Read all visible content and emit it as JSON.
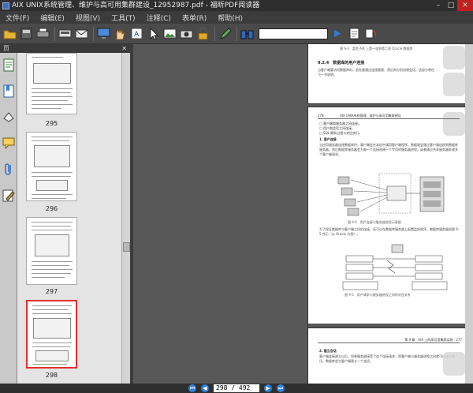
{
  "window": {
    "title": "AIX UNIX系统管理、维护与高可用集群建设_12952987.pdf - 福昕PDF阅读器"
  },
  "menu": [
    "文件(F)",
    "编辑(E)",
    "视图(V)",
    "工具(T)",
    "注释(C)",
    "表单(R)",
    "帮助(H)"
  ],
  "toolbar": {
    "icons": [
      "open-icon",
      "print-icon",
      "printer-icon",
      "scan-icon",
      "email-icon",
      "hand-icon",
      "select-text-icon",
      "pointer-icon",
      "snapshot-icon",
      "image-icon",
      "lock-icon",
      "pen-icon",
      "binoculars-icon",
      "zoom-in-icon",
      "fit-icon",
      "rotate-icon"
    ],
    "search_value": ""
  },
  "sidebar": {
    "header": "页",
    "close": "✕",
    "tabs": [
      "pages-tab",
      "bookmarks-tab",
      "layers-tab",
      "comments-tab",
      "attachments-tab",
      "sign-tab"
    ],
    "thumbnails": [
      {
        "label": "295"
      },
      {
        "label": "296"
      },
      {
        "label": "297"
      },
      {
        "label": "298",
        "selected": true
      }
    ]
  },
  "document": {
    "top_page": {
      "caption": "图 9-3　监控 AIX 上第一张到第二张 Oracle 数据库",
      "section": "9.2.4　数据库的用户连接",
      "body": "当客户端要访问数据库时，首先要通过连接管理，然后再分别创建会话，这部分将在下一节说明。"
    },
    "main_page": {
      "header_left": "278",
      "header_mid": "AIX UNIX系统管理、维护与高可用集群建设",
      "list": [
        "□ 客户端和服务器之间连接。",
        "□ 用户和会话之间连接。",
        "□ SQL 解析过程与对应执行。"
      ],
      "section": "1. 客户连接",
      "para1": "当应用服务器连接数据库时，客户端会在本机中调用客户端程序，数据就会通过客户端连接到数据库服务器，然后数据库服务器会为每一个连接创建一个专用的服务器进程，或者通过共享服务器处理多个客户端请求。",
      "fig1_caption": "图 9-4　用户连接与服务器进程示意图",
      "para2": "为了保证数据库与客户端之间的连接，还可以在数据库服务器上配置监听程序，数据库服务器如图 9-5 所示（以 Oracle 为例）。",
      "fig2_caption": "图 9-5　用户请求与服务器进程之间的对应关系",
      "footer_right": "第 9 章　AIX 上的高可用集群实践　277",
      "section2": "2. 建立会话",
      "para3": "客户端连接建立以后，如果服务器接受了这个连接请求，则客户端与服务器进程之间就可以进行通讯，数据库会为客户端建立一个会话。"
    }
  },
  "status": {
    "page_indicator": "298 / 492"
  }
}
